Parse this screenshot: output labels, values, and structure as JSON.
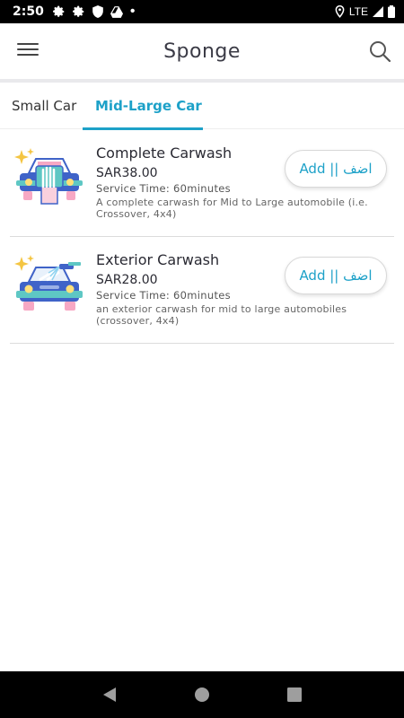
{
  "status_bar": {
    "time": "2:50",
    "network": "LTE",
    "left_icons": [
      "gear-icon",
      "gear-icon",
      "shield-icon",
      "drive-icon",
      "dot-icon"
    ],
    "right_icons": [
      "location-icon",
      "signal-icon",
      "battery-icon"
    ]
  },
  "app_bar": {
    "title": "Sponge",
    "menu_icon": "hamburger-menu-icon",
    "search_icon": "search-icon"
  },
  "tabs": [
    {
      "label": "Small Car",
      "selected": false
    },
    {
      "label": "Mid-Large Car",
      "selected": true
    }
  ],
  "services": [
    {
      "name": "Complete Carwash",
      "price": "SAR38.00",
      "service_time": "Service Time: 60minutes",
      "description": "A complete carwash for Mid to Large automobile (i.e. Crossover, 4x4)",
      "add_label": "Add || اضف",
      "icon": "car-hand-wash-icon"
    },
    {
      "name": "Exterior Carwash",
      "price": "SAR28.00",
      "service_time": "Service Time: 60minutes",
      "description": "an exterior carwash for mid to large automobiles (crossover, 4x4)",
      "add_label": "Add || اضف",
      "icon": "car-spray-wash-icon"
    }
  ],
  "nav_bar": {
    "back_icon": "back-triangle-icon",
    "home_icon": "home-circle-icon",
    "recents_icon": "recents-square-icon"
  },
  "colors": {
    "accent": "#1da1c8",
    "text_dark": "#2a2a33",
    "car_blue": "#3f63c8",
    "sparkle": "#f4c542"
  }
}
